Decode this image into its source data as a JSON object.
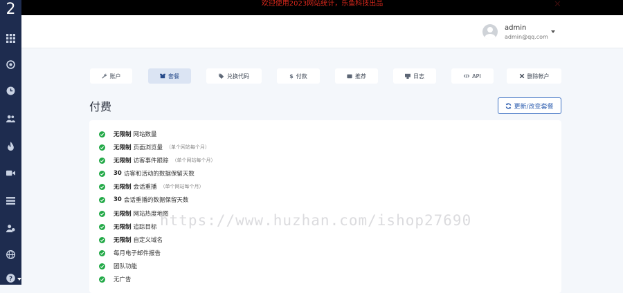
{
  "sidebar": {
    "logo_text": "2",
    "icons": [
      "grid-icon",
      "target-icon",
      "clock-icon",
      "users-icon",
      "fire-icon",
      "video-icon",
      "list-icon",
      "team-icon",
      "globe-icon",
      "question-icon"
    ]
  },
  "announcement": {
    "text": "欢迎使用2023网站统计，乐鱼科技出品",
    "close": "✕",
    "color": "#d9281c"
  },
  "user": {
    "name": "admin",
    "email": "admin@qq.com"
  },
  "tabs": [
    {
      "label": "账户",
      "icon": "wrench-icon"
    },
    {
      "label": "套餐",
      "icon": "box-icon"
    },
    {
      "label": "兑换代码",
      "icon": "tags-icon"
    },
    {
      "label": "付款",
      "icon": "dollar-icon"
    },
    {
      "label": "推荐",
      "icon": "wallet-icon"
    },
    {
      "label": "日志",
      "icon": "log-icon"
    },
    {
      "label": "API",
      "icon": "code-icon"
    },
    {
      "label": "删除帐户",
      "icon": "times-icon"
    }
  ],
  "page": {
    "title": "付费",
    "renew_button": "更新/改变套餐"
  },
  "features": [
    {
      "bold": "无限制",
      "text": "网站数量",
      "note": ""
    },
    {
      "bold": "无限制",
      "text": "页面浏览量",
      "note": "（单个网站每个月）"
    },
    {
      "bold": "无限制",
      "text": "访客事件跟踪",
      "note": "（单个网站每个月）"
    },
    {
      "bold": "30",
      "text": "访客和活动的数据保留天数",
      "note": ""
    },
    {
      "bold": "无限制",
      "text": "会话重播",
      "note": "（单个网站每个月）"
    },
    {
      "bold": "30",
      "text": "会话重播的数据保留天数",
      "note": ""
    },
    {
      "bold": "无限制",
      "text": "网站热度地图",
      "note": ""
    },
    {
      "bold": "无限制",
      "text": "追踪目标",
      "note": ""
    },
    {
      "bold": "无限制",
      "text": "自定义域名",
      "note": ""
    },
    {
      "bold": "",
      "text": "每月电子邮件报告",
      "note": ""
    },
    {
      "bold": "",
      "text": "团队功能",
      "note": ""
    },
    {
      "bold": "",
      "text": "无广告",
      "note": ""
    }
  ],
  "watermark": "https://www.huzhan.com/ishop27690",
  "colors": {
    "sidebar": "#1e2c4f",
    "accent": "#3b6fc2",
    "check": "#22a947"
  }
}
